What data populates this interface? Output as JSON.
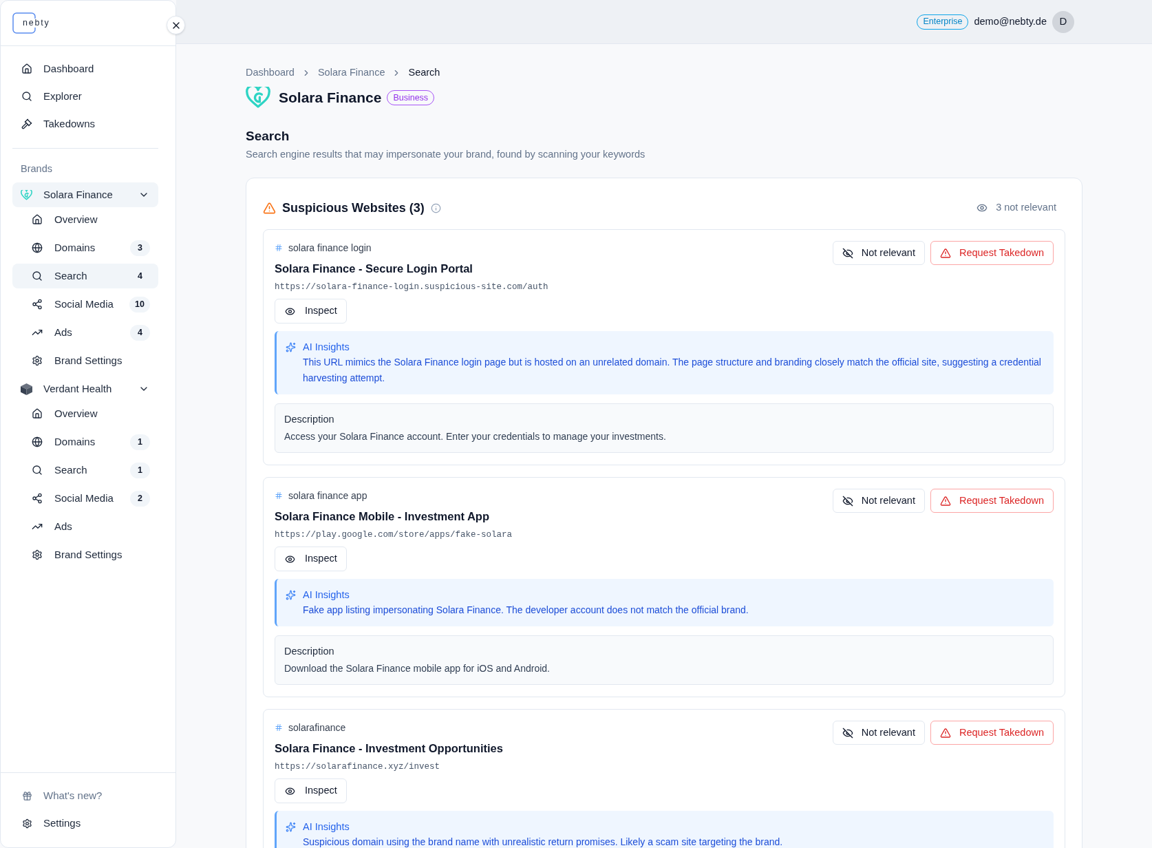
{
  "sidebar": {
    "logo": "nebty",
    "nav": [
      {
        "label": "Dashboard",
        "selected": false
      },
      {
        "label": "Explorer",
        "selected": false
      },
      {
        "label": "Takedowns",
        "selected": false
      }
    ],
    "brands_heading": "Brands",
    "brands": [
      {
        "name": "Solara Finance",
        "selected": true,
        "expanded": true,
        "items": [
          {
            "label": "Overview",
            "selected": false
          },
          {
            "label": "Domains",
            "count": "3",
            "selected": false
          },
          {
            "label": "Search",
            "count": "4",
            "selected": true
          },
          {
            "label": "Social Media",
            "count": "10",
            "selected": false
          },
          {
            "label": "Ads",
            "count": "4",
            "selected": false
          },
          {
            "label": "Brand Settings",
            "selected": false
          }
        ]
      },
      {
        "name": "Verdant Health",
        "selected": false,
        "expanded": true,
        "items": [
          {
            "label": "Overview",
            "selected": false
          },
          {
            "label": "Domains",
            "count": "1",
            "selected": false
          },
          {
            "label": "Search",
            "count": "1",
            "selected": false
          },
          {
            "label": "Social Media",
            "count": "2",
            "selected": false
          },
          {
            "label": "Ads",
            "selected": false
          },
          {
            "label": "Brand Settings",
            "selected": false
          }
        ]
      }
    ],
    "footer": [
      {
        "label": "What's new?",
        "muted": true
      },
      {
        "label": "Settings",
        "muted": false
      }
    ]
  },
  "header": {
    "plan": "Enterprise",
    "email": "demo@nebty.de",
    "avatar": "D"
  },
  "breadcrumb": [
    {
      "label": "Dashboard",
      "current": false
    },
    {
      "label": "Solara Finance",
      "current": false
    },
    {
      "label": "Search",
      "current": true
    }
  ],
  "brand": {
    "name": "Solara Finance",
    "tier": "Business"
  },
  "page": {
    "title": "Search",
    "subtitle": "Search engine results that may impersonate your brand, found by scanning your keywords"
  },
  "panel": {
    "title": "Suspicious Websites (3)",
    "not_relevant": "3 not relevant",
    "results": [
      {
        "keyword": "solara finance login",
        "title": "Solara Finance - Secure Login Portal",
        "url": "https://solara-finance-login.suspicious-site.com/auth",
        "inspect": "Inspect",
        "not_relevant": "Not relevant",
        "takedown": "Request Takedown",
        "insights_label": "AI Insights",
        "insights": "This URL mimics the Solara Finance login page but is hosted on an unrelated domain. The page structure and branding closely match the official site, suggesting a credential harvesting attempt.",
        "description_label": "Description",
        "description": "Access your Solara Finance account. Enter your credentials to manage your investments."
      },
      {
        "keyword": "solara finance app",
        "title": "Solara Finance Mobile - Investment App",
        "url": "https://play.google.com/store/apps/fake-solara",
        "inspect": "Inspect",
        "not_relevant": "Not relevant",
        "takedown": "Request Takedown",
        "insights_label": "AI Insights",
        "insights": "Fake app listing impersonating Solara Finance. The developer account does not match the official brand.",
        "description_label": "Description",
        "description": "Download the Solara Finance mobile app for iOS and Android."
      },
      {
        "keyword": "solarafinance",
        "title": "Solara Finance - Investment Opportunities",
        "url": "https://solarafinance.xyz/invest",
        "inspect": "Inspect",
        "not_relevant": "Not relevant",
        "takedown": "Request Takedown",
        "insights_label": "AI Insights",
        "insights": "Suspicious domain using the brand name with unrealistic return promises. Likely a scam site targeting the brand."
      }
    ]
  }
}
